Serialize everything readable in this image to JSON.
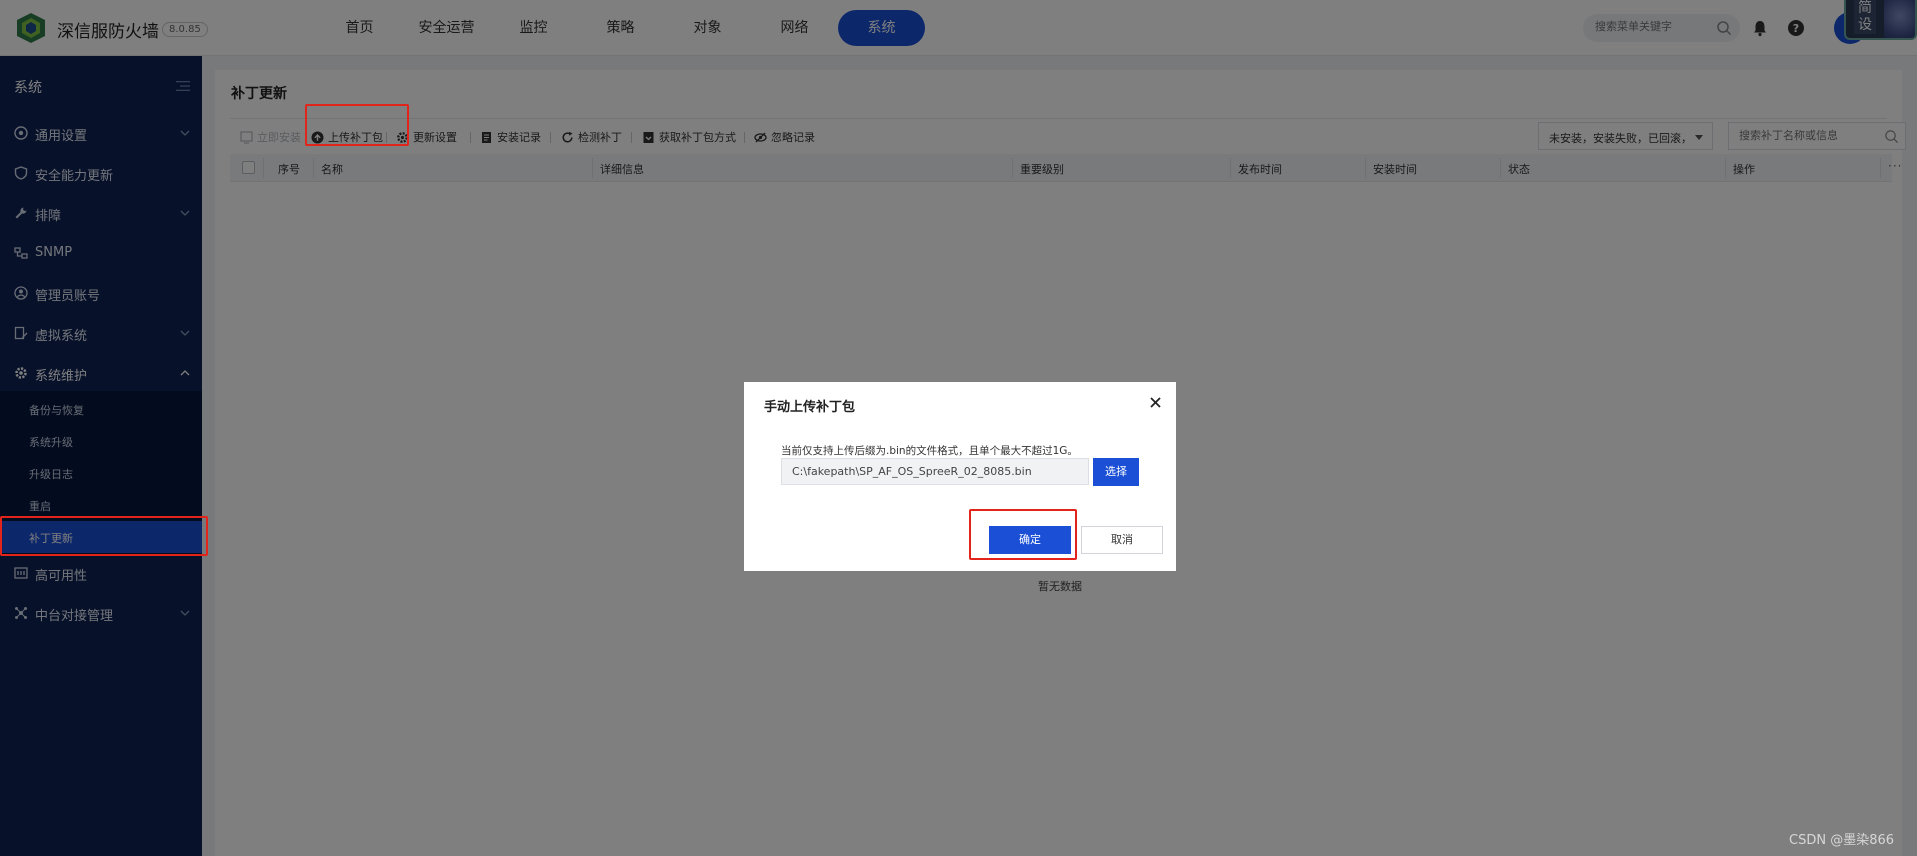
{
  "header": {
    "brand": "深信服防火墙",
    "version": "8.0.85",
    "nav": [
      "首页",
      "安全运营",
      "监控",
      "策略",
      "对象",
      "网络",
      "系统"
    ],
    "active_nav_index": 6,
    "search_placeholder": "搜索菜单关键字",
    "corner_badge": "简\n设"
  },
  "sidebar": {
    "title": "系统",
    "items": [
      {
        "label": "通用设置",
        "icon": "gear-circle-icon",
        "chevron": "down"
      },
      {
        "label": "安全能力更新",
        "icon": "shield-icon",
        "chevron": ""
      },
      {
        "label": "排障",
        "icon": "wrench-icon",
        "chevron": "down"
      },
      {
        "label": "SNMP",
        "icon": "network-icon",
        "chevron": ""
      },
      {
        "label": "管理员账号",
        "icon": "user-circle-icon",
        "chevron": ""
      },
      {
        "label": "虚拟系统",
        "icon": "document-edit-icon",
        "chevron": "down"
      },
      {
        "label": "系统维护",
        "icon": "gear-icon",
        "chevron": "up"
      },
      {
        "label": "高可用性",
        "icon": "ha-icon",
        "chevron": ""
      },
      {
        "label": "中台对接管理",
        "icon": "hub-icon",
        "chevron": "down"
      }
    ],
    "sub_items": [
      "备份与恢复",
      "系统升级",
      "升级日志",
      "重启",
      "补丁更新"
    ],
    "active_sub_index": 4
  },
  "main": {
    "title": "补丁更新",
    "toolbar": {
      "install_now": "立即安装",
      "upload_patch": "上传补丁包",
      "update_settings": "更新设置",
      "install_log": "安装记录",
      "detect_patch": "检测补丁",
      "get_patch_method": "获取补丁包方式",
      "ignore_log": "忽略记录"
    },
    "filter_value": "未安装，安装失败，已回滚，",
    "search_placeholder": "搜索补丁名称或信息",
    "columns": [
      "序号",
      "名称",
      "详细信息",
      "重要级别",
      "发布时间",
      "安装时间",
      "状态",
      "操作"
    ],
    "empty_text": "暂无数据"
  },
  "dialog": {
    "title": "手动上传补丁包",
    "hint": "当前仅支持上传后缀为.bin的文件格式，且单个最大不超过1G。",
    "file_value": "C:\\fakepath\\SP_AF_OS_SpreeR_02_8085.bin",
    "choose_label": "选择",
    "ok_label": "确定",
    "cancel_label": "取消"
  },
  "watermark": "CSDN @墨染866",
  "colors": {
    "primary": "#1a4fd6",
    "sidebar": "#0f2255",
    "highlight": "#e3241b"
  }
}
